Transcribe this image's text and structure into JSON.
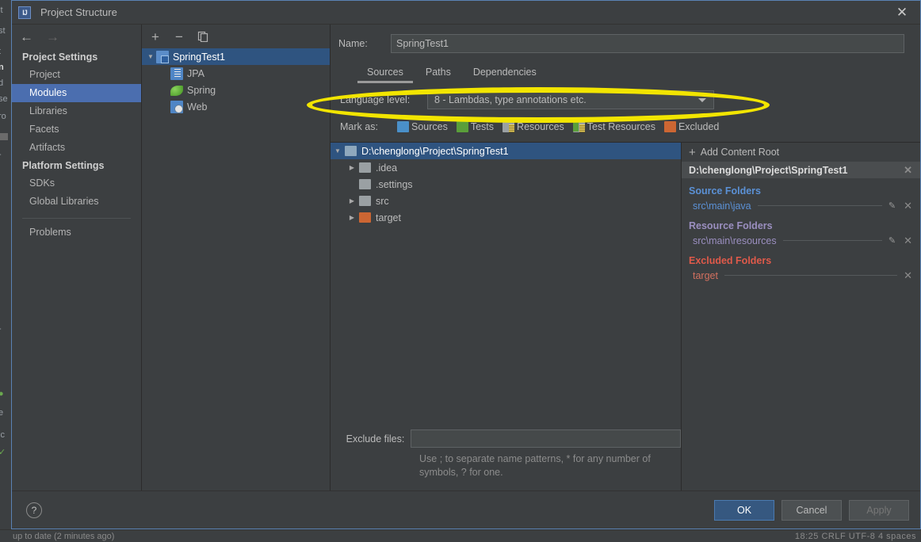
{
  "ide": {
    "status_left": "up to date (2 minutes ago)",
    "status_right": "18:25   CRLF   UTF-8   4 spaces",
    "left_strip_fragments": [
      "it",
      "st",
      "t",
      "n",
      "d",
      "se",
      "ro",
      "-"
    ]
  },
  "dialog": {
    "title": "Project Structure",
    "app_icon_text": "IJ",
    "close_icon": "close-icon"
  },
  "nav": {
    "back_icon": "arrow-left-icon",
    "forward_icon": "arrow-right-icon"
  },
  "sidebar": {
    "groups": [
      {
        "label": "Project Settings",
        "items": [
          {
            "label": "Project",
            "selected": false
          },
          {
            "label": "Modules",
            "selected": true
          },
          {
            "label": "Libraries",
            "selected": false
          },
          {
            "label": "Facets",
            "selected": false
          },
          {
            "label": "Artifacts",
            "selected": false
          }
        ]
      },
      {
        "label": "Platform Settings",
        "items": [
          {
            "label": "SDKs",
            "selected": false
          },
          {
            "label": "Global Libraries",
            "selected": false
          }
        ]
      }
    ],
    "problems_label": "Problems"
  },
  "module_toolbar": {
    "add_label": "+",
    "remove_label": "−",
    "copy_icon": "copy-icon"
  },
  "module_tree": [
    {
      "label": "SpringTest1",
      "icon": "module-icon",
      "level": 0,
      "expanded": true,
      "selected": true
    },
    {
      "label": "JPA",
      "icon": "jpa-facet-icon",
      "level": 1,
      "expanded": null,
      "selected": false
    },
    {
      "label": "Spring",
      "icon": "spring-facet-icon",
      "level": 1,
      "expanded": null,
      "selected": false
    },
    {
      "label": "Web",
      "icon": "web-facet-icon",
      "level": 1,
      "expanded": null,
      "selected": false
    }
  ],
  "module_editor": {
    "name_label": "Name:",
    "name_value": "SpringTest1",
    "tabs": [
      {
        "label": "Sources",
        "active": true
      },
      {
        "label": "Paths",
        "active": false
      },
      {
        "label": "Dependencies",
        "active": false
      }
    ],
    "language_level_label": "Language level:",
    "language_level_value": "8 - Lambdas, type annotations etc.",
    "language_level_caret": "chevron-down-icon",
    "mark_as_label": "Mark as:",
    "mark_as_options": [
      {
        "label": "Sources",
        "color": "#4a90c9"
      },
      {
        "label": "Tests",
        "color": "#5a9e3a"
      },
      {
        "label": "Resources",
        "color": "#9aa0a3"
      },
      {
        "label": "Test Resources",
        "color": "#9aa0a3"
      },
      {
        "label": "Excluded",
        "color": "#cc6633"
      }
    ],
    "exclude_files_label": "Exclude files:",
    "exclude_files_value": "",
    "exclude_files_hint": "Use ; to separate name patterns, * for any number of symbols, ? for one."
  },
  "file_tree": [
    {
      "label": "D:\\chenglong\\Project\\SpringTest1",
      "level": 0,
      "twisty": "▼",
      "icon": "folder-blue-icon",
      "selected": true
    },
    {
      "label": ".idea",
      "level": 1,
      "twisty": "▶",
      "icon": "folder-gray-icon",
      "selected": false
    },
    {
      "label": ".settings",
      "level": 1,
      "twisty": "",
      "icon": "folder-gray-icon",
      "selected": false
    },
    {
      "label": "src",
      "level": 1,
      "twisty": "▶",
      "icon": "folder-gray-icon",
      "selected": false
    },
    {
      "label": "target",
      "level": 1,
      "twisty": "▶",
      "icon": "folder-orange-icon",
      "selected": false
    }
  ],
  "roots_panel": {
    "add_content_root_label": "Add Content Root",
    "content_root_path": "D:\\chenglong\\Project\\SpringTest1",
    "sections": [
      {
        "title": "Source Folders",
        "color": "#5b91d6",
        "entries": [
          {
            "path": "src\\main\\java",
            "has_edit": true,
            "has_remove": true
          }
        ]
      },
      {
        "title": "Resource Folders",
        "color": "#9b8fc0",
        "entries": [
          {
            "path": "src\\main\\resources",
            "has_edit": true,
            "has_remove": true
          }
        ]
      },
      {
        "title": "Excluded Folders",
        "color": "#e05a4a",
        "entries": [
          {
            "path": "target",
            "has_edit": false,
            "has_remove": true
          }
        ]
      }
    ]
  },
  "footer": {
    "help_label": "?",
    "ok_label": "OK",
    "cancel_label": "Cancel",
    "apply_label": "Apply"
  },
  "annotation": {
    "type": "ellipse-highlight",
    "color": "#f2e500",
    "targets": "language-level-row"
  },
  "colors": {
    "dialog_bg": "#3c3f41",
    "field_bg": "#45494a",
    "selection_blue": "#4b6eaf",
    "tree_selection": "#2f5480",
    "primary_button": "#365880",
    "highlight_yellow": "#f2e500"
  }
}
